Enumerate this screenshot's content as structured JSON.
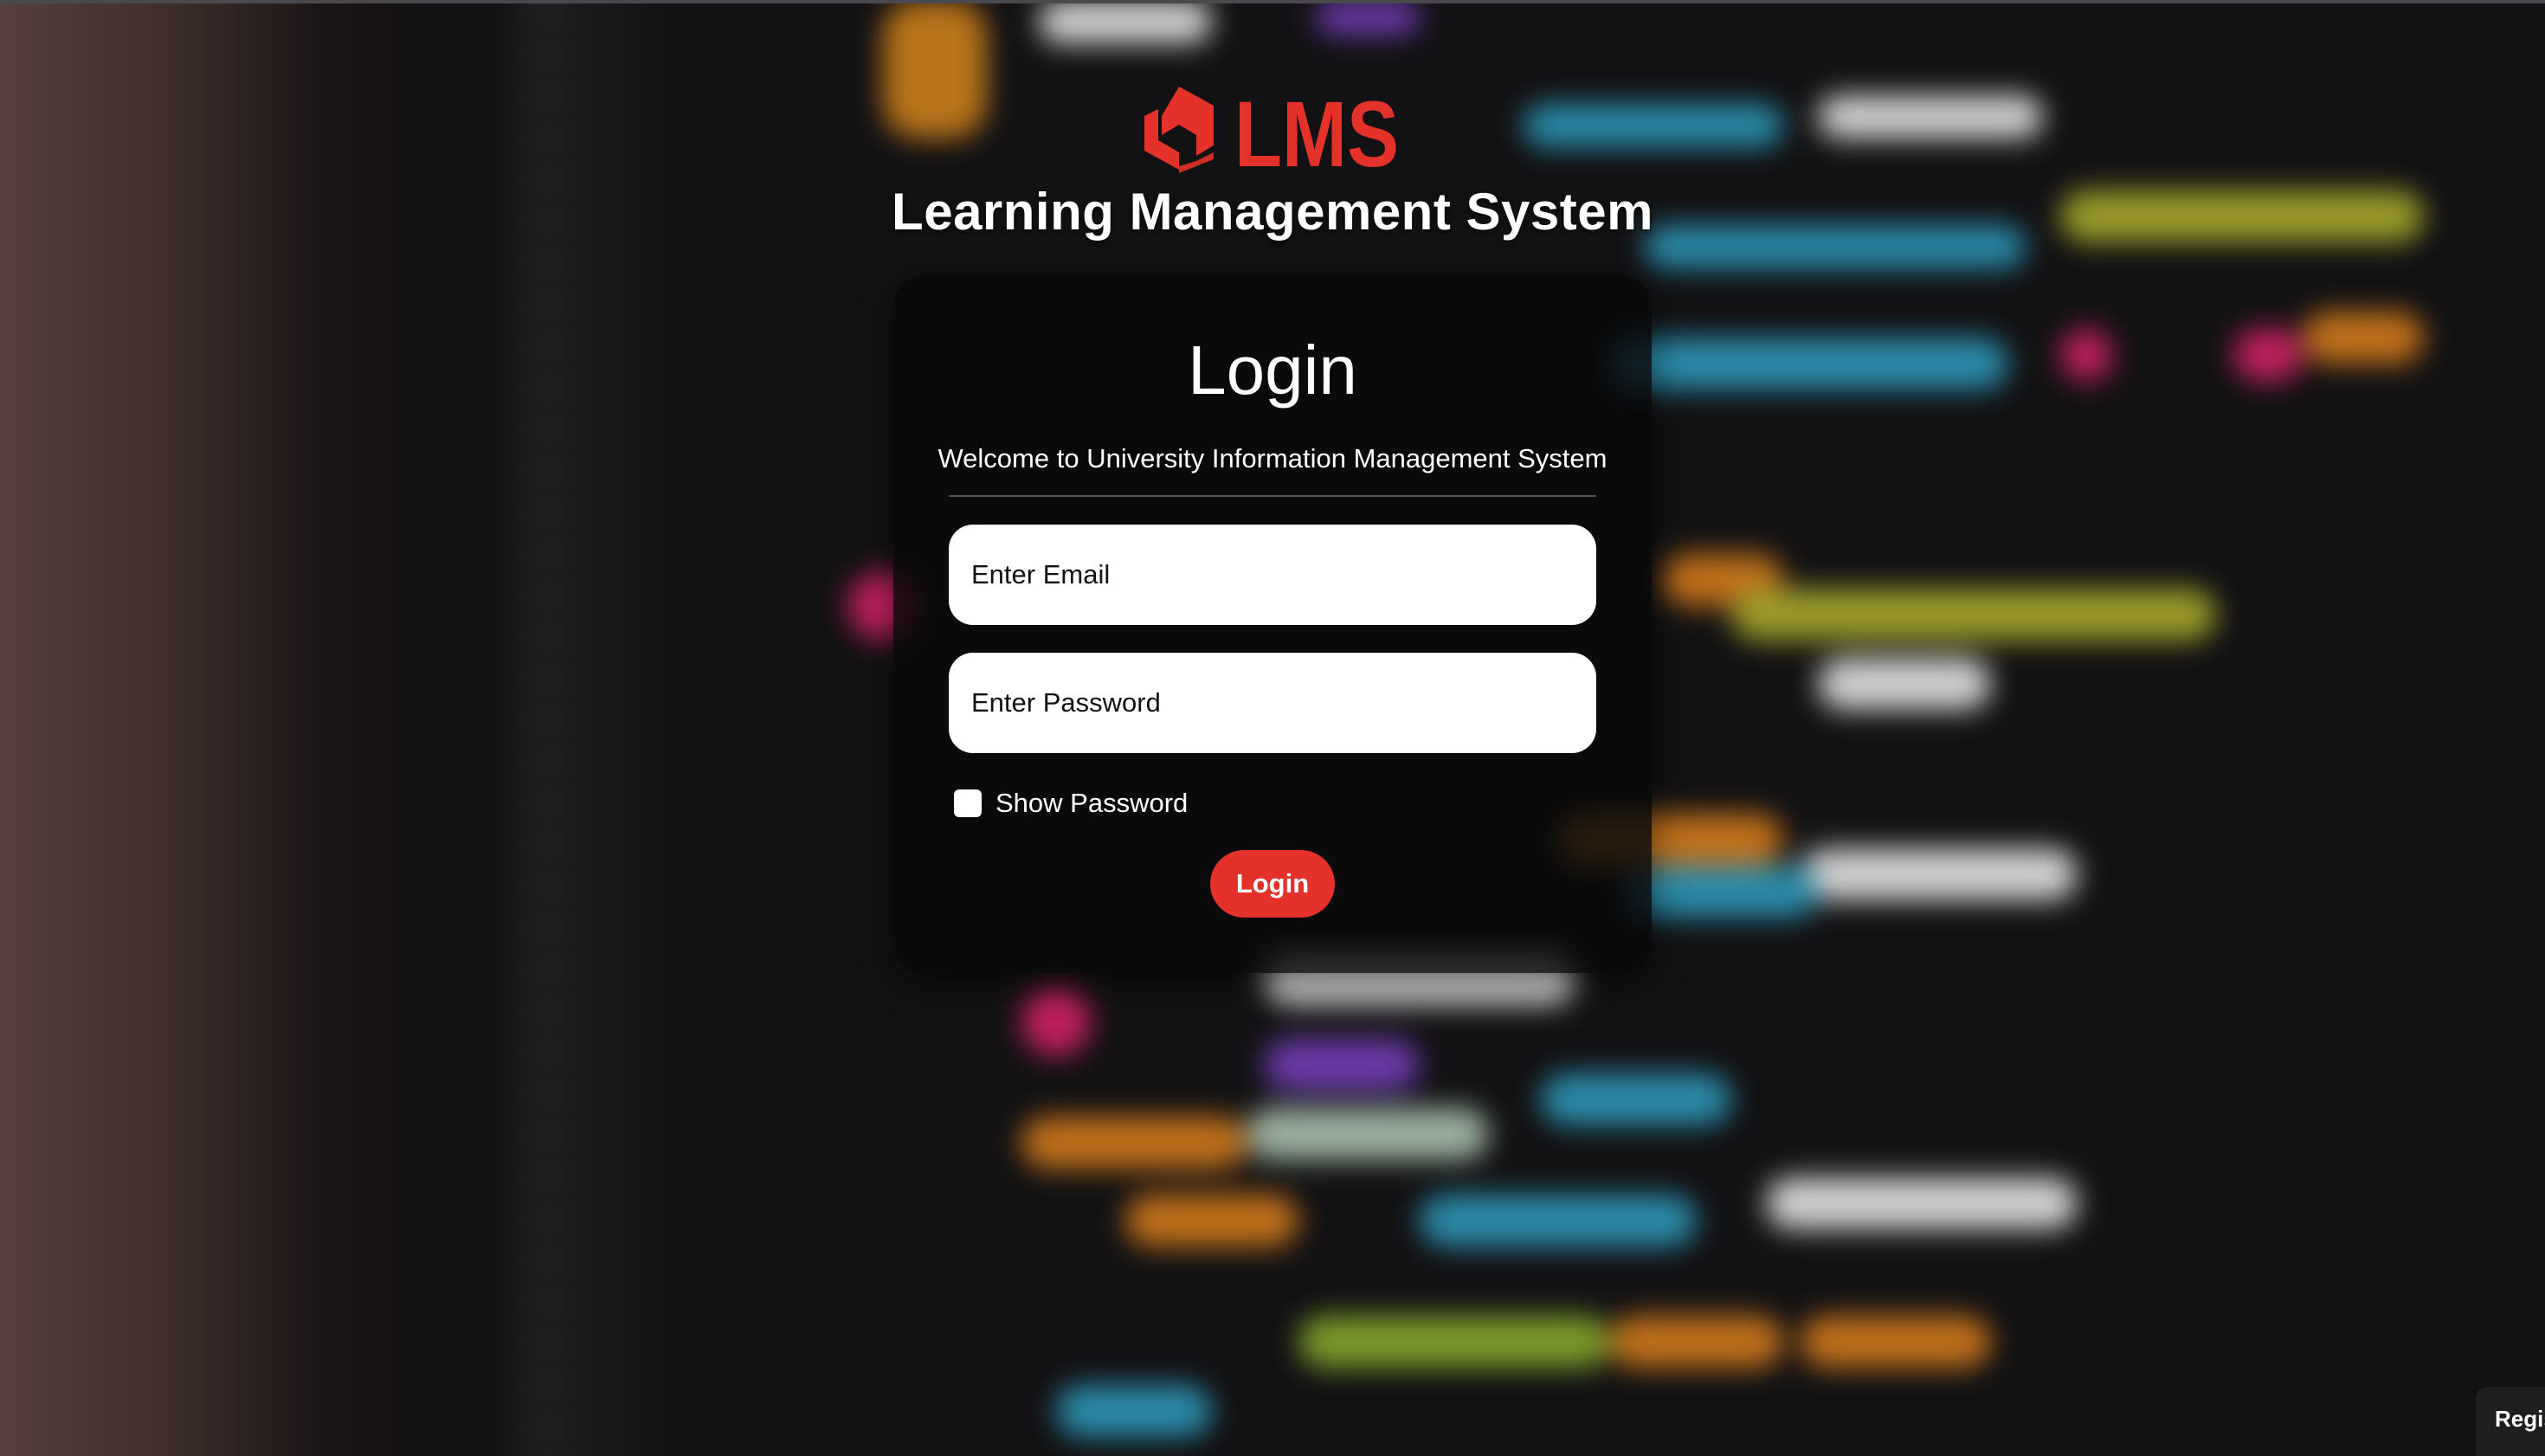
{
  "brand": {
    "logo_text": "LMS",
    "logo_icon": "hexagon-cube-icon",
    "app_title": "Learning Management System",
    "accent_color": "#e4312a"
  },
  "login_card": {
    "title": "Login",
    "subtitle": "Welcome to University Information Management System",
    "email_placeholder": "Enter Email",
    "password_placeholder": "Enter Password",
    "show_password_label": "Show Password",
    "show_password_checked": false,
    "login_button": "Login"
  },
  "corner_tab": {
    "label": "Regis"
  }
}
